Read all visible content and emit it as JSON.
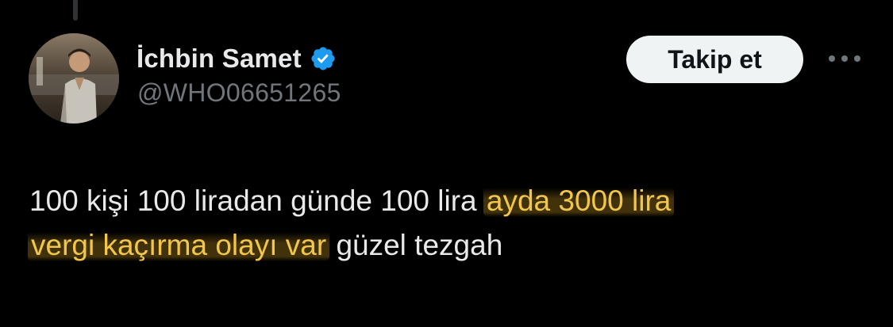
{
  "author": {
    "display_name": "İchbin Samet",
    "handle": "@WHO06651265",
    "verified": true
  },
  "header": {
    "follow_label": "Takip et",
    "more_icon": "more-dots-icon"
  },
  "tweet": {
    "text_plain_1": "100 kişi 100 liradan günde 100 lira ",
    "text_highlight_1": "ayda 3000 lira",
    "text_highlight_2": "vergi kaçırma olayı var",
    "text_plain_2": " güzel tezgah"
  },
  "colors": {
    "background": "#000000",
    "text": "#e7e9ea",
    "secondary": "#71767b",
    "verified": "#1d9bf0",
    "highlight_text": "#f1c64b",
    "button_bg": "#eff3f4"
  }
}
